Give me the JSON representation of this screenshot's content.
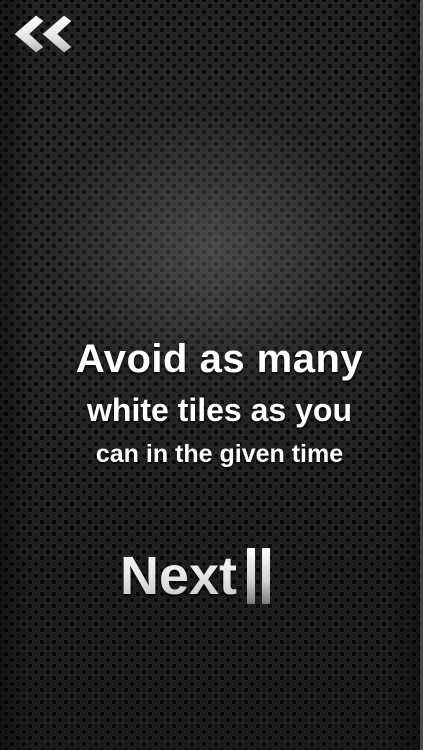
{
  "navigation": {
    "back_icon": "double-chevron-left-icon"
  },
  "instructions": {
    "line_1": "Avoid as many",
    "line_2": "white tiles as you",
    "line_3": "can in the given time"
  },
  "next_button": {
    "label": "Next"
  },
  "colors": {
    "background": "#1b1b1b",
    "text": "#ffffff"
  }
}
